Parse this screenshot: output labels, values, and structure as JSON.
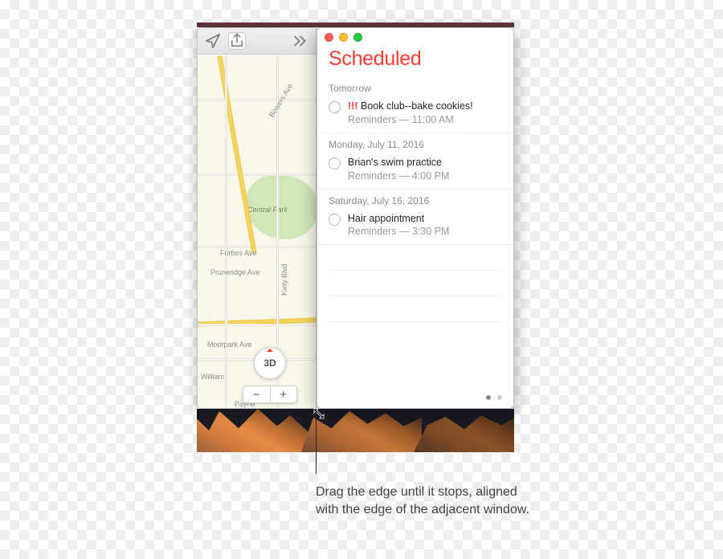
{
  "maps": {
    "compass_label": "3D",
    "zoom_minus": "−",
    "zoom_plus": "+",
    "park_label": "Central Park",
    "streets": {
      "bowers": "Bowers Ave",
      "forbes": "Forbes Ave",
      "pruneridge": "Pruneridge Ave",
      "kiely": "Kiely Blvd",
      "moorpark": "Moorpark Ave",
      "williams": "William",
      "payne": "Payne"
    }
  },
  "reminders": {
    "title": "Scheduled",
    "groups": [
      {
        "label": "Tomorrow",
        "items": [
          {
            "priority": "!!!",
            "title": "Book club--bake cookies!",
            "meta": "Reminders — 11:00 AM"
          }
        ]
      },
      {
        "label": "Monday, July 11, 2016",
        "items": [
          {
            "priority": "",
            "title": "Brian's swim practice",
            "meta": "Reminders — 4:00 PM"
          }
        ]
      },
      {
        "label": "Saturday, July 16, 2016",
        "items": [
          {
            "priority": "",
            "title": "Hair appointment",
            "meta": "Reminders — 3:30 PM"
          }
        ]
      }
    ]
  },
  "callout": "Drag the edge until it stops, aligned with the edge of the adjacent window."
}
